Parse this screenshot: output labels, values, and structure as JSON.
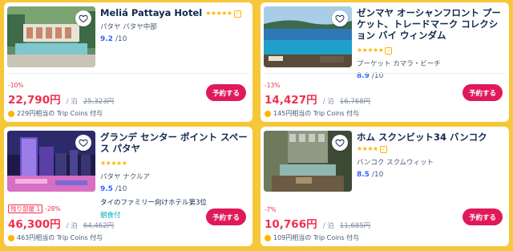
{
  "colors": {
    "background": "#f7c73a",
    "price": "#f0304f",
    "book_button": "#e0195a",
    "rating": "#3264ff",
    "stars": "#ffb400"
  },
  "hotels": [
    {
      "name": "Meliá Pattaya Hotel",
      "stars": "★★★★★",
      "location": "パタヤ パタヤ中部",
      "rating_score": "9.2",
      "rating_max": "/10",
      "tag": "",
      "tag2": "",
      "discount_label": "",
      "discount": "-10%",
      "price": "22,790円",
      "per_night": "/ 泊",
      "original_price": "25,323円",
      "coins_amount": "229円",
      "coins_text": "相当の Trip Coins 付与",
      "book_label": "予約する",
      "favorite_icon": "heart-outline-icon"
    },
    {
      "name": "ゼンマヤ オーシャンフロント プーケット、トレードマーク コレクション バイ ウィンダム",
      "stars": "★★★★★",
      "location": "プーケット カマラ・ビーチ",
      "rating_score": "8.9",
      "rating_max": "/10",
      "tag": "",
      "tag2": "",
      "discount_label": "",
      "discount": "-13%",
      "price": "14,427円",
      "per_night": "/ 泊",
      "original_price": "16,768円",
      "coins_amount": "145円",
      "coins_text": "相当の Trip Coins 付与",
      "book_label": "予約する",
      "favorite_icon": "heart-outline-icon"
    },
    {
      "name": "グランデ センター ポイント スペース パタヤ",
      "stars": "★★★★★",
      "location": "パタヤ ナクルア",
      "rating_score": "9.5",
      "rating_max": "/10",
      "tag": "タイのファミリー向けホテル第3位",
      "tag2": "朝食付",
      "discount_label": "残り部屋 1",
      "discount": "-28%",
      "price": "46,300円",
      "per_night": "/ 泊",
      "original_price": "64,462円",
      "coins_amount": "463円",
      "coins_text": "相当の Trip Coins 付与",
      "book_label": "予約する",
      "favorite_icon": "heart-outline-icon"
    },
    {
      "name": "ホム スクンビット34 バンコク",
      "stars": "★★★★",
      "location": "バンコク スクムウィット",
      "rating_score": "8.5",
      "rating_max": "/10",
      "tag": "",
      "tag2": "",
      "discount_label": "",
      "discount": "-7%",
      "price": "10,766円",
      "per_night": "/ 泊",
      "original_price": "11,685円",
      "coins_amount": "109円",
      "coins_text": "相当の Trip Coins 付与",
      "book_label": "予約する",
      "favorite_icon": "heart-outline-icon"
    }
  ]
}
